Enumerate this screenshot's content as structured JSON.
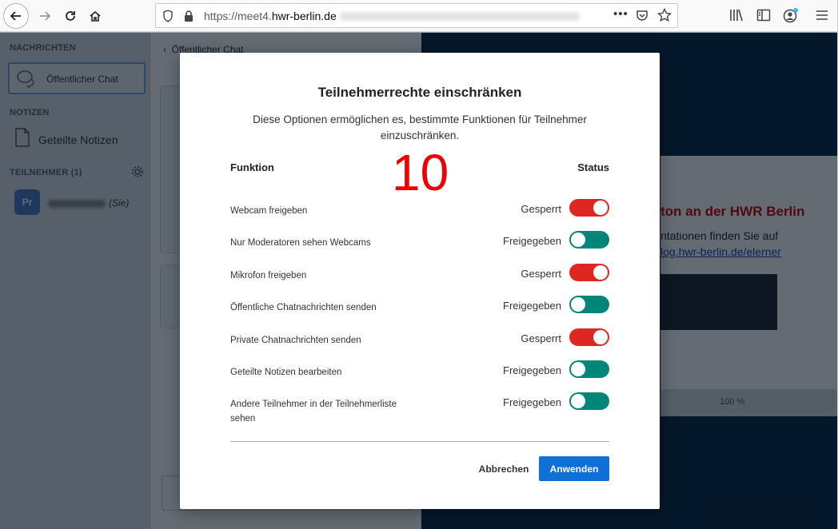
{
  "browser": {
    "url_prefix": "https://meet4.",
    "url_domain": "hwr-berlin.de",
    "menu_dots": "•••"
  },
  "sidebar": {
    "messages_title": "NACHRICHTEN",
    "public_chat": "Öffentlicher Chat",
    "notes_title": "NOTIZEN",
    "shared_notes": "Geteilte Notizen",
    "participants_title": "TEILNEHMER (1)",
    "avatar_initials": "Pr",
    "you_suffix": "(Sie)"
  },
  "chat": {
    "header": "Öffentlicher Chat"
  },
  "slide": {
    "title": "ton an der HWR Berlin",
    "text": "ntationen finden Sie auf",
    "link": "log.hwr-berlin.de/elerner",
    "zoom": "100 %"
  },
  "modal": {
    "title": "Teilnehmerrechte einschränken",
    "description": "Diese Optionen ermöglichen es, bestimmte Funktionen für Teilnehmer einzuschränken.",
    "col_function": "Funktion",
    "col_status": "Status",
    "annotation": "10",
    "rows": [
      {
        "label": "Webcam freigeben",
        "status": "Gesperrt",
        "locked": true
      },
      {
        "label": "Nur Moderatoren sehen Webcams",
        "status": "Freigegeben",
        "locked": false
      },
      {
        "label": "Mikrofon freigeben",
        "status": "Gesperrt",
        "locked": true
      },
      {
        "label": "Öffentliche Chatnachrichten senden",
        "status": "Freigegeben",
        "locked": false
      },
      {
        "label": "Private Chatnachrichten senden",
        "status": "Gesperrt",
        "locked": true
      },
      {
        "label": "Geteilte Notizen bearbeiten",
        "status": "Freigegeben",
        "locked": false
      },
      {
        "label": "Andere Teilnehmer in der Teilnehmerliste sehen",
        "status": "Freigegeben",
        "locked": false
      }
    ],
    "cancel_label": "Abbrechen",
    "apply_label": "Anwenden"
  },
  "colors": {
    "locked": "#df2721",
    "unlocked": "#00857a",
    "primary": "#0f70d7",
    "annotation": "#ee0000"
  }
}
